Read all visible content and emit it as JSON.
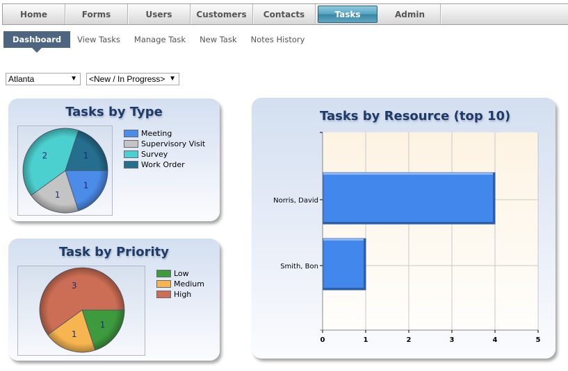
{
  "topnav": {
    "tabs": [
      {
        "label": "Home",
        "active": false
      },
      {
        "label": "Forms",
        "active": false
      },
      {
        "label": "Users",
        "active": false
      },
      {
        "label": "Customers",
        "active": false
      },
      {
        "label": "Contacts",
        "active": false
      },
      {
        "label": "Tasks",
        "active": true
      },
      {
        "label": "Admin",
        "active": false
      }
    ]
  },
  "subnav": {
    "items": [
      {
        "label": "Dashboard",
        "active": true
      },
      {
        "label": "View Tasks",
        "active": false
      },
      {
        "label": "Manage Task",
        "active": false
      },
      {
        "label": "New Task",
        "active": false
      },
      {
        "label": "Notes History",
        "active": false
      }
    ]
  },
  "filters": {
    "city": {
      "value": "Atlanta",
      "arrow": "▼"
    },
    "status": {
      "value": "<New / In Progress>",
      "arrow": "▼"
    }
  },
  "chart_data": [
    {
      "type": "pie",
      "title": "Tasks by Type",
      "categories": [
        "Meeting",
        "Supervisory Visit",
        "Survey",
        "Work Order"
      ],
      "values": [
        1,
        1,
        2,
        1
      ],
      "colors": [
        "#4a8ce8",
        "#c4c4c4",
        "#4ccfcf",
        "#256e8e"
      ],
      "data_labels": [
        "1",
        "1",
        "2",
        "1"
      ],
      "legend": "right"
    },
    {
      "type": "pie",
      "title": "Task by Priority",
      "categories": [
        "Low",
        "Medium",
        "High"
      ],
      "values": [
        1,
        1,
        3
      ],
      "colors": [
        "#3d9a3d",
        "#f7b550",
        "#cc6e55"
      ],
      "data_labels": [
        "1",
        "1",
        "3"
      ],
      "legend": "right"
    },
    {
      "type": "bar",
      "orientation": "horizontal",
      "title": "Tasks by Resource (top 10)",
      "categories": [
        "Norris, David",
        "Smith, Bon"
      ],
      "values": [
        4,
        1
      ],
      "color": "#4287eb",
      "xlim": [
        0,
        5
      ],
      "xticks": [
        "0",
        "1",
        "2",
        "3",
        "4",
        "5"
      ],
      "grid": true,
      "xlabel": "",
      "ylabel": ""
    }
  ]
}
